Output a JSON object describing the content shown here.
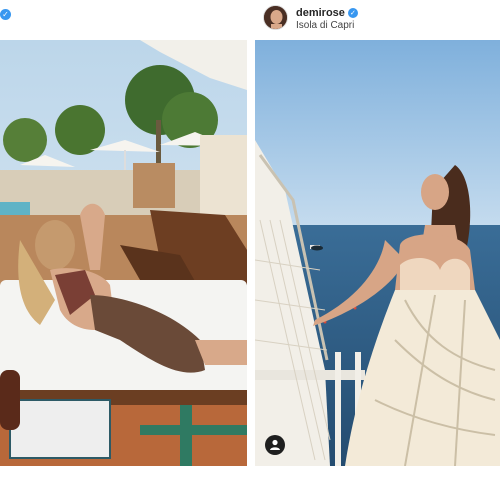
{
  "left_post": {
    "verified_icon": "✓"
  },
  "right_post": {
    "username": "demirose",
    "verified_icon": "✓",
    "location": "Isola di Capri",
    "tag_icon": "user-tag-icon"
  },
  "colors": {
    "verified_blue": "#3897f0",
    "text_dark": "#262626",
    "sea": "#2f5c86",
    "sky": "#9cc3e4"
  }
}
